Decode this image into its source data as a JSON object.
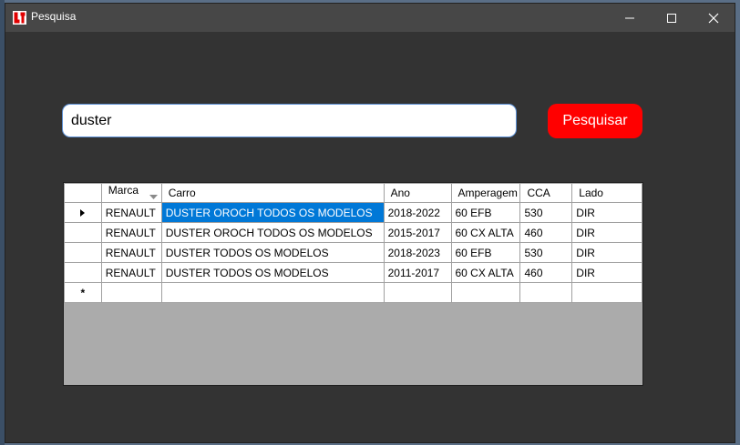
{
  "window": {
    "title": "Pesquisa"
  },
  "search": {
    "value": "duster",
    "button_label": "Pesquisar"
  },
  "grid": {
    "columns": [
      "Marca",
      "Carro",
      "Ano",
      "Amperagem",
      "CCA",
      "Lado"
    ],
    "rows": [
      [
        "RENAULT",
        "DUSTER OROCH TODOS OS MODELOS",
        "2018-2022",
        "60 EFB",
        "530",
        "DIR"
      ],
      [
        "RENAULT",
        "DUSTER OROCH TODOS OS MODELOS",
        "2015-2017",
        "60 CX ALTA",
        "460",
        "DIR"
      ],
      [
        "RENAULT",
        "DUSTER TODOS OS MODELOS",
        "2018-2023",
        "60 EFB",
        "530",
        "DIR"
      ],
      [
        "RENAULT",
        "DUSTER TODOS OS MODELOS",
        "2011-2017",
        "60 CX ALTA",
        "460",
        "DIR"
      ]
    ],
    "new_row_marker": "*"
  },
  "icons": {
    "app": "app-logo-icon",
    "minimize": "minimize-icon",
    "maximize": "maximize-icon",
    "close": "close-icon",
    "sort": "sort-down-icon",
    "current_row": "current-row-arrow-icon"
  },
  "colors": {
    "accent_button": "#ff0000",
    "selection": "#0078d7",
    "form_background": "#333333"
  }
}
